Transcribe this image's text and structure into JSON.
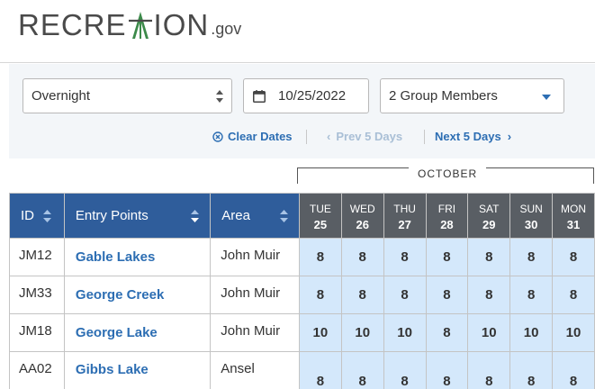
{
  "brand": {
    "word_start": "RECRE",
    "word_end": "ION",
    "suffix": ".gov",
    "tree_color": "#3c8a4a"
  },
  "filters": {
    "stay_type": "Overnight",
    "date": "10/25/2022",
    "group": "2 Group Members"
  },
  "nav": {
    "clear": "Clear Dates",
    "prev": "Prev 5 Days",
    "next": "Next 5 Days"
  },
  "calendar": {
    "month": "OCTOBER",
    "days": [
      {
        "dow": "TUE",
        "num": "25"
      },
      {
        "dow": "WED",
        "num": "26"
      },
      {
        "dow": "THU",
        "num": "27"
      },
      {
        "dow": "FRI",
        "num": "28"
      },
      {
        "dow": "SAT",
        "num": "29"
      },
      {
        "dow": "SUN",
        "num": "30"
      },
      {
        "dow": "MON",
        "num": "31"
      }
    ]
  },
  "table": {
    "headers": {
      "id": "ID",
      "entry": "Entry Points",
      "area": "Area"
    },
    "rows": [
      {
        "id": "JM12",
        "entry": "Gable Lakes",
        "area": "John Muir",
        "values": [
          "8",
          "8",
          "8",
          "8",
          "8",
          "8",
          "8"
        ]
      },
      {
        "id": "JM33",
        "entry": "George Creek",
        "area": "John Muir",
        "values": [
          "8",
          "8",
          "8",
          "8",
          "8",
          "8",
          "8"
        ]
      },
      {
        "id": "JM18",
        "entry": "George Lake",
        "area": "John Muir",
        "values": [
          "10",
          "10",
          "10",
          "8",
          "10",
          "10",
          "10"
        ]
      },
      {
        "id": "AA02",
        "entry": "Gibbs Lake",
        "area": "Ansel",
        "values": [
          "8",
          "8",
          "8",
          "8",
          "8",
          "8",
          "8"
        ]
      }
    ]
  },
  "colors": {
    "header_blue": "#2f5d9b",
    "day_header_gray": "#595e64",
    "cell_blue": "#d4e8fb",
    "link_blue": "#2d6eb3"
  }
}
